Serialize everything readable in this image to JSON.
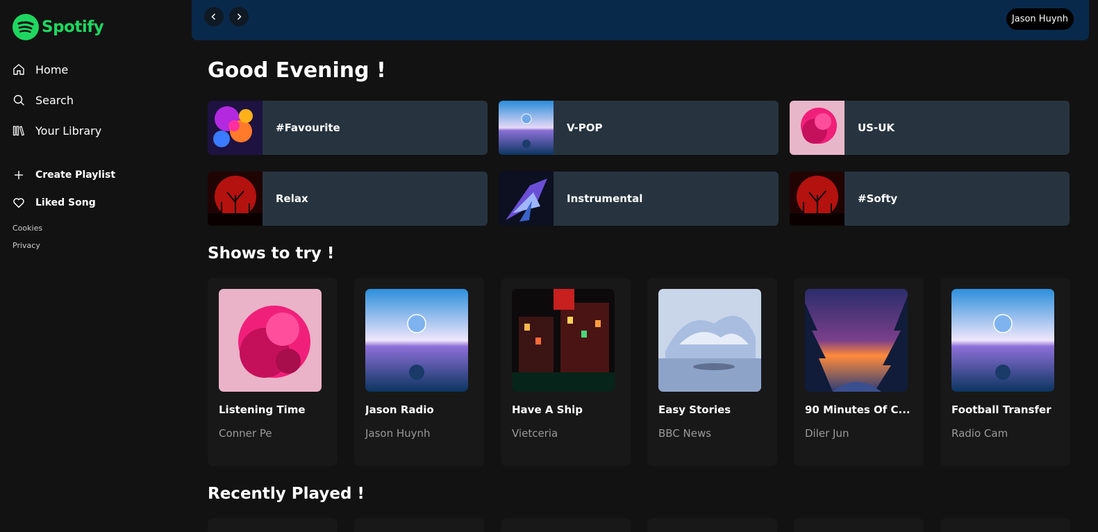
{
  "brand": {
    "name": "Spotify",
    "color": "#1ed760"
  },
  "sidebar": {
    "nav": [
      {
        "label": "Home",
        "icon": "home-icon"
      },
      {
        "label": "Search",
        "icon": "search-icon"
      },
      {
        "label": "Your Library",
        "icon": "library-icon"
      }
    ],
    "actions": [
      {
        "label": "Create Playlist",
        "icon": "plus-icon"
      },
      {
        "label": "Liked Song",
        "icon": "heart-icon"
      }
    ],
    "links": [
      "Cookies",
      "Privacy"
    ]
  },
  "topbar": {
    "back_icon": "chevron-left-icon",
    "forward_icon": "chevron-right-icon",
    "user": "Jason Huynh"
  },
  "greeting": "Good Evening !",
  "quick_playlists": [
    "#Favourite",
    "V-POP",
    "US-UK",
    "Relax",
    "Instrumental",
    "#Softy"
  ],
  "shows_title": "Shows to try !",
  "shows": [
    {
      "title": "Listening Time",
      "subtitle": "Conner Pe"
    },
    {
      "title": "Jason Radio",
      "subtitle": "Jason Huynh"
    },
    {
      "title": "Have A Ship",
      "subtitle": "Vietceria"
    },
    {
      "title": "Easy Stories",
      "subtitle": "BBC News"
    },
    {
      "title": "90 Minutes Of C...",
      "subtitle": "Diler Jun"
    },
    {
      "title": "Football Transfer",
      "subtitle": "Radio Cam"
    }
  ],
  "recent_title": "Recently Played !"
}
